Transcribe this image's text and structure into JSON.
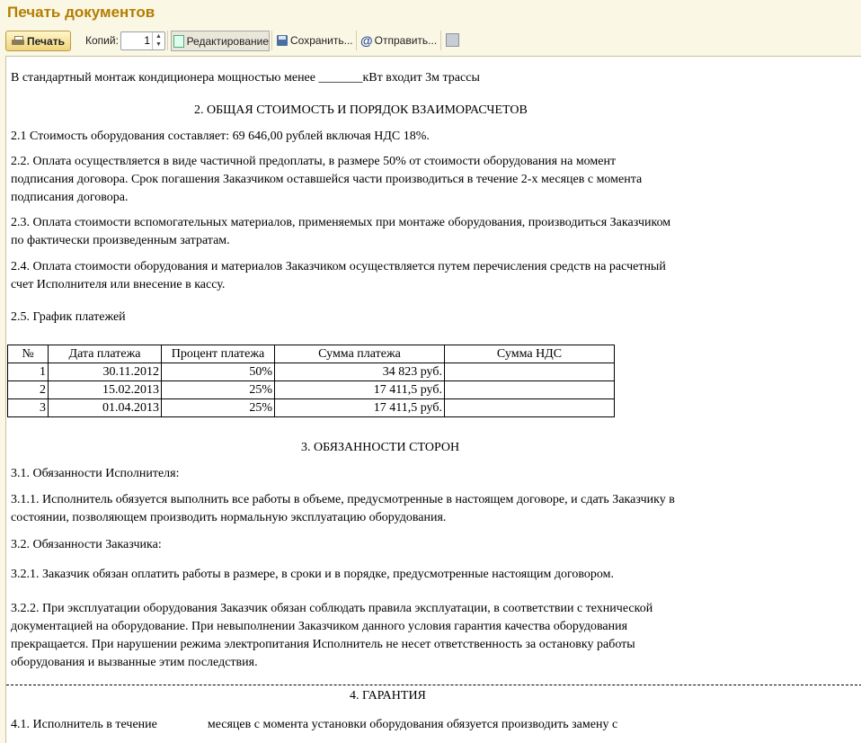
{
  "window": {
    "title": "Печать документов"
  },
  "toolbar": {
    "print_label": "Печать",
    "copies_label": "Копий:",
    "copies_value": "1",
    "edit_label": "Редактирование",
    "save_label": "Сохранить...",
    "send_label": "Отправить..."
  },
  "document": {
    "intro": "В стандартный монтаж кондиционера мощностью менее  _______кВт входит 3м трассы",
    "section2_title": "2. ОБЩАЯ СТОИМОСТЬ И ПОРЯДОК ВЗАИМОРАСЧЕТОВ",
    "p2_1": "2.1 Стоимость оборудования составляет: 69 646,00 рублей включая НДС 18%.",
    "p2_2_l1": "2.2. Оплата осуществляется в виде частичной предоплаты, в размере 50% от стоимости оборудования на момент",
    "p2_2_l2": "подписания договора. Срок погашения Заказчиком оставшейся части производиться в течение  2-х месяцев с момента",
    "p2_2_l3": "подписания договора.",
    "p2_3_l1": "2.3. Оплата стоимости вспомогательных материалов, применяемых при монтаже оборудования, производиться Заказчиком",
    "p2_3_l2": "по фактически произведенным затратам.",
    "p2_4_l1": "2.4. Оплата стоимости оборудования и материалов Заказчиком осуществляется путем перечисления средств на расчетный",
    "p2_4_l2": "счет Исполнителя или внесение в кассу.",
    "p2_5": "2.5. График платежей",
    "table": {
      "headers": [
        "№",
        "Дата платежа",
        "Процент платежа",
        "Сумма платежа",
        "Сумма НДС"
      ],
      "rows": [
        [
          "1",
          "30.11.2012",
          "50%",
          "34 823 руб.",
          ""
        ],
        [
          "2",
          "15.02.2013",
          "25%",
          "17 411,5 руб.",
          ""
        ],
        [
          "3",
          "01.04.2013",
          "25%",
          "17 411,5 руб.",
          ""
        ]
      ]
    },
    "section3_title": "3. ОБЯЗАННОСТИ СТОРОН",
    "s3_1_title": "3.1. Обязанности Исполнителя:",
    "p3_1_1_l1": "3.1.1. Исполнитель обязуется выполнить все работы в объеме, предусмотренные в настоящем договоре, и сдать Заказчику в",
    "p3_1_1_l2": "состоянии, позволяющем производить нормальную эксплуатацию оборудования.",
    "s3_2_title": "3.2. Обязанности Заказчика:",
    "p3_2_1": "3.2.1. Заказчик обязан оплатить работы в размере, в сроки и в порядке, предусмотренные настоящим договором.",
    "p3_2_2_l1": "3.2.2. При эксплуатации оборудования Заказчик обязан соблюдать правила эксплуатации, в соответствии с технической",
    "p3_2_2_l2": "документацией на оборудование. При невыполнении Заказчиком данного условия гарантия качества оборудования",
    "p3_2_2_l3": "прекращается. При нарушении режима электропитания Исполнитель не несет ответственность за остановку работы",
    "p3_2_2_l4": "оборудования и вызванные этим последствия.",
    "section4_title": "4. ГАРАНТИЯ",
    "p4_1_l1": "4.1. Исполнитель в течение                месяцев с момента установки оборудования обязуется производить замену с"
  }
}
